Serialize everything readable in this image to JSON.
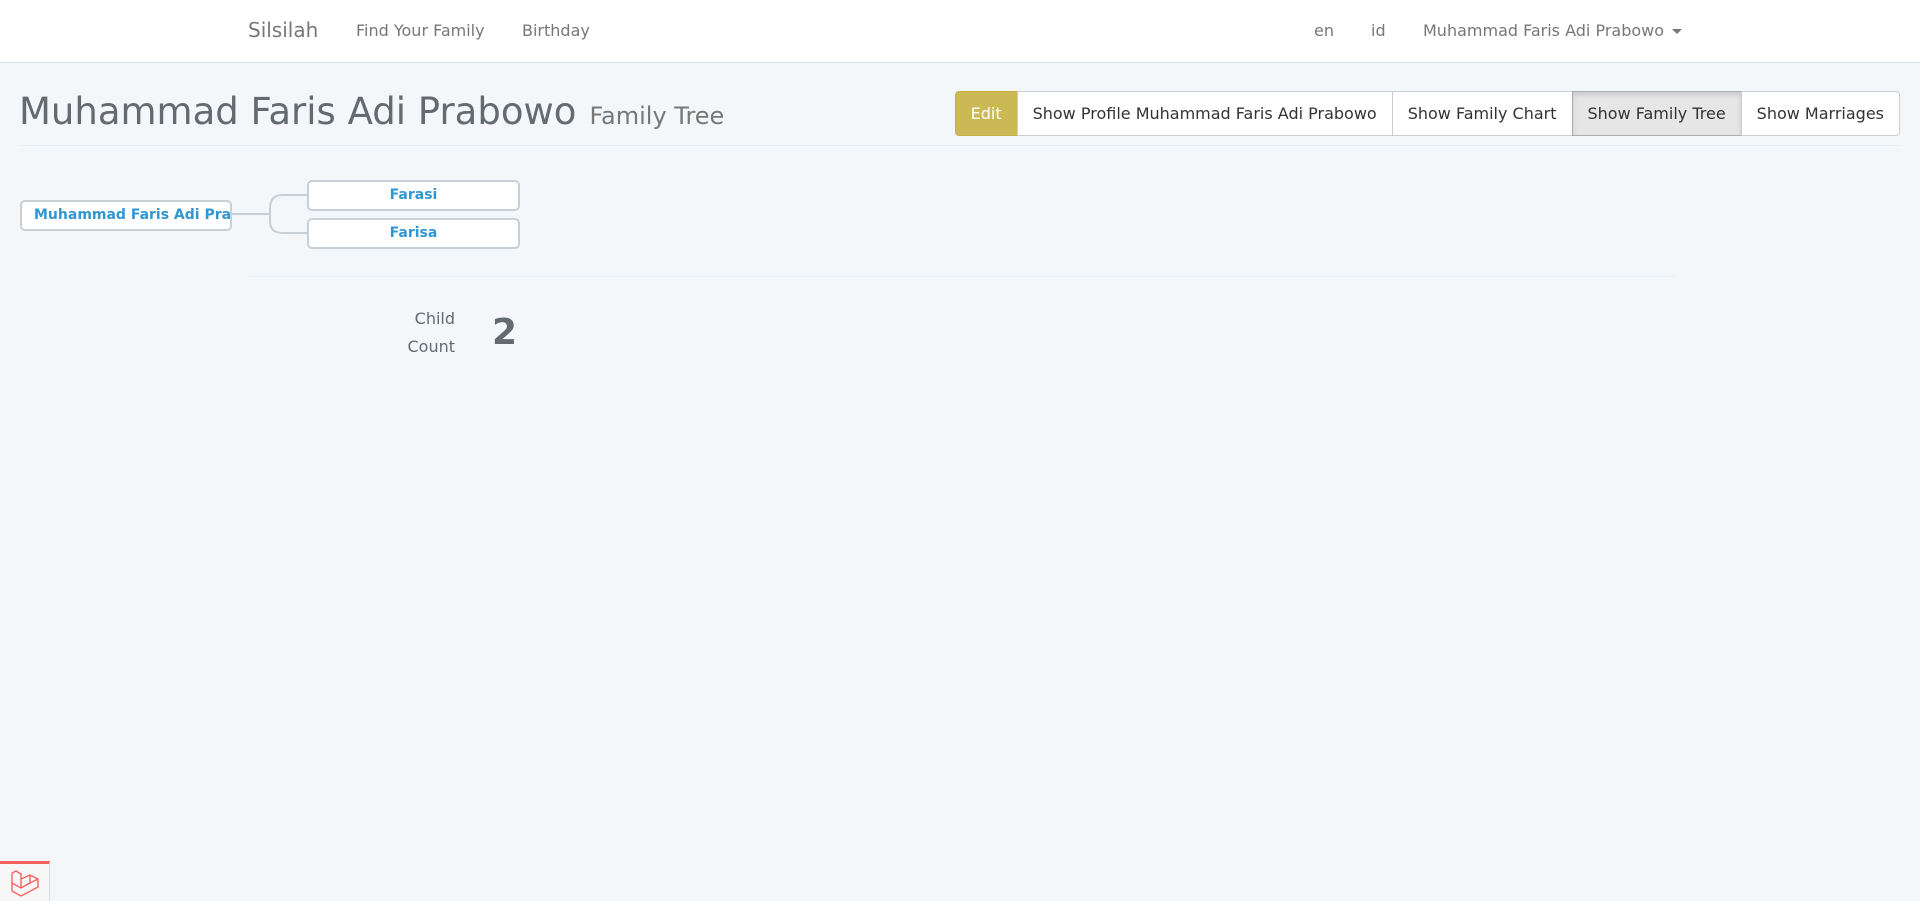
{
  "navbar": {
    "brand": "Silsilah",
    "links": [
      {
        "label": "Find Your Family"
      },
      {
        "label": "Birthday"
      }
    ],
    "lang": [
      {
        "label": "en"
      },
      {
        "label": "id"
      }
    ],
    "user": "Muhammad Faris Adi Prabowo"
  },
  "page": {
    "title": "Muhammad Faris Adi Prabowo",
    "subtitle": "Family Tree"
  },
  "actions": {
    "edit": "Edit",
    "show_profile": "Show Profile Muhammad Faris Adi Prabowo",
    "show_chart": "Show Family Chart",
    "show_tree": "Show Family Tree",
    "show_marriages": "Show Marriages"
  },
  "tree": {
    "root": "Muhammad Faris Adi Prabowo",
    "children": [
      "Farasi",
      "Farisa"
    ]
  },
  "stats": {
    "child_label_1": "Child",
    "child_label_2": "Count",
    "child_count": "2"
  },
  "colors": {
    "background": "#f3f7f9",
    "edit_button": "#cbb956",
    "link": "#3097d1",
    "debugbar_accent": "#f4645f"
  },
  "icons": {
    "debugbar": "laravel-logo-icon",
    "user_menu": "caret-down-icon"
  }
}
